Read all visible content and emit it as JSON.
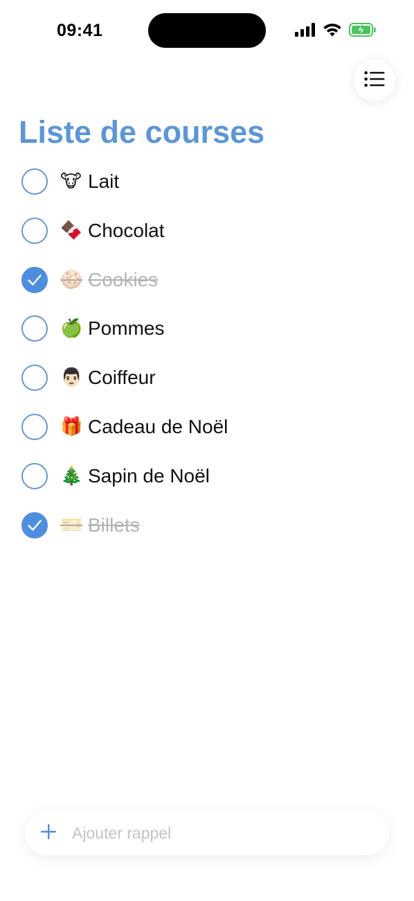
{
  "status_bar": {
    "time": "09:41"
  },
  "header": {
    "menu_icon": "list-bullet-icon",
    "title": "Liste de courses"
  },
  "colors": {
    "accent": "#5b96d6",
    "checkbox": "#4f8ede",
    "done_text": "#b4b4b4"
  },
  "reminders": [
    {
      "emoji": "🐮",
      "label": "Lait",
      "done": false
    },
    {
      "emoji": "🍫",
      "label": "Chocolat",
      "done": false
    },
    {
      "emoji": "🍪",
      "label": "Cookies",
      "done": true
    },
    {
      "emoji": "🍏",
      "label": "Pommes",
      "done": false
    },
    {
      "emoji": "👨🏻",
      "label": "Coiffeur",
      "done": false
    },
    {
      "emoji": "🎁",
      "label": "Cadeau de Noël",
      "done": false
    },
    {
      "emoji": "🎄",
      "label": "Sapin de Noël",
      "done": false
    },
    {
      "emoji": "🎫",
      "label": "Billets",
      "done": true
    }
  ],
  "add_bar": {
    "icon": "plus-icon",
    "placeholder": "Ajouter rappel"
  }
}
